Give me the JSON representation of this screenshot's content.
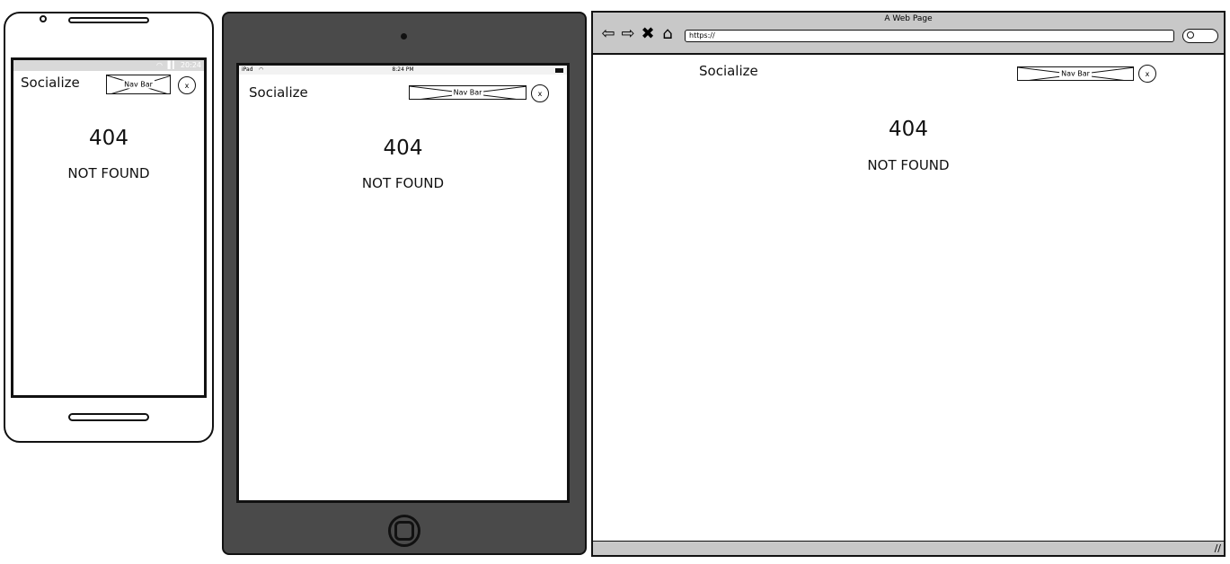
{
  "phone": {
    "status_time": "20:24",
    "brand": "Socialize",
    "navbar_label": "Nav Bar",
    "close_label": "x",
    "error_code": "404",
    "error_text": "NOT FOUND"
  },
  "tablet": {
    "status_device": "iPad",
    "status_time": "8:24 PM",
    "brand": "Socialize",
    "navbar_label": "Nav Bar",
    "close_label": "x",
    "error_code": "404",
    "error_text": "NOT FOUND"
  },
  "browser": {
    "title": "A Web Page",
    "url": "https://",
    "brand": "Socialize",
    "navbar_label": "Nav Bar",
    "close_label": "x",
    "error_code": "404",
    "error_text": "NOT FOUND"
  },
  "icons": [
    "back-arrow-icon",
    "forward-arrow-icon",
    "stop-icon",
    "home-icon",
    "search-icon",
    "wifi-icon",
    "signal-icon",
    "battery-icon",
    "resize-grip-icon"
  ]
}
